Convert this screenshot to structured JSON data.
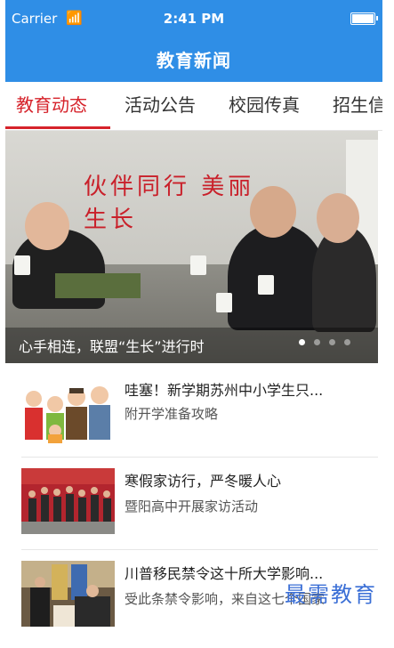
{
  "status": {
    "carrier": "Carrier",
    "time": "2:41 PM"
  },
  "nav": {
    "title": "教育新闻"
  },
  "tabs": [
    {
      "label": "教育动态",
      "active": true
    },
    {
      "label": "活动公告"
    },
    {
      "label": "校园传真"
    },
    {
      "label": "招生信"
    }
  ],
  "banner": {
    "caption": "心手相连，联盟“生长”进行时",
    "wall_text": "伙伴同行 美丽生长",
    "page_indicator": {
      "count": 4,
      "current": 1
    }
  },
  "news": [
    {
      "title": "哇塞！新学期苏州中小学生只...",
      "subtitle": "附开学准备攻略"
    },
    {
      "title": "寒假家访行，严冬暖人心",
      "subtitle": "暨阳高中开展家访活动"
    },
    {
      "title": "川普移民禁令这十所大学影响...",
      "subtitle": "受此条禁令影响，来自这七个国家"
    }
  ],
  "watermark": "最需教育",
  "colors": {
    "accent": "#2f8ee6",
    "tab_active": "#d6232b"
  }
}
